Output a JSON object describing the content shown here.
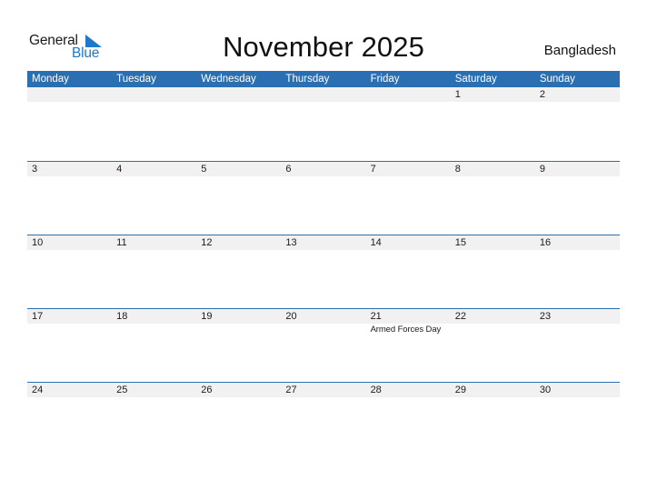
{
  "logo": {
    "text_general": "General",
    "text_blue": "Blue",
    "icon": "triangle-flag-icon"
  },
  "title": "November 2025",
  "country": "Bangladesh",
  "colors": {
    "header_bg": "#2b6fb3",
    "logo_blue": "#1f78c8",
    "date_strip": "#f1f1f1"
  },
  "weekdays": [
    "Monday",
    "Tuesday",
    "Wednesday",
    "Thursday",
    "Friday",
    "Saturday",
    "Sunday"
  ],
  "weeks": [
    {
      "days": [
        {
          "num": ""
        },
        {
          "num": ""
        },
        {
          "num": ""
        },
        {
          "num": ""
        },
        {
          "num": ""
        },
        {
          "num": "1"
        },
        {
          "num": "2"
        }
      ]
    },
    {
      "days": [
        {
          "num": "3"
        },
        {
          "num": "4"
        },
        {
          "num": "5"
        },
        {
          "num": "6"
        },
        {
          "num": "7"
        },
        {
          "num": "8"
        },
        {
          "num": "9"
        }
      ]
    },
    {
      "days": [
        {
          "num": "10"
        },
        {
          "num": "11"
        },
        {
          "num": "12"
        },
        {
          "num": "13"
        },
        {
          "num": "14"
        },
        {
          "num": "15"
        },
        {
          "num": "16"
        }
      ]
    },
    {
      "days": [
        {
          "num": "17"
        },
        {
          "num": "18"
        },
        {
          "num": "19"
        },
        {
          "num": "20"
        },
        {
          "num": "21",
          "event": "Armed Forces Day"
        },
        {
          "num": "22"
        },
        {
          "num": "23"
        }
      ]
    },
    {
      "days": [
        {
          "num": "24"
        },
        {
          "num": "25"
        },
        {
          "num": "26"
        },
        {
          "num": "27"
        },
        {
          "num": "28"
        },
        {
          "num": "29"
        },
        {
          "num": "30"
        }
      ]
    }
  ]
}
